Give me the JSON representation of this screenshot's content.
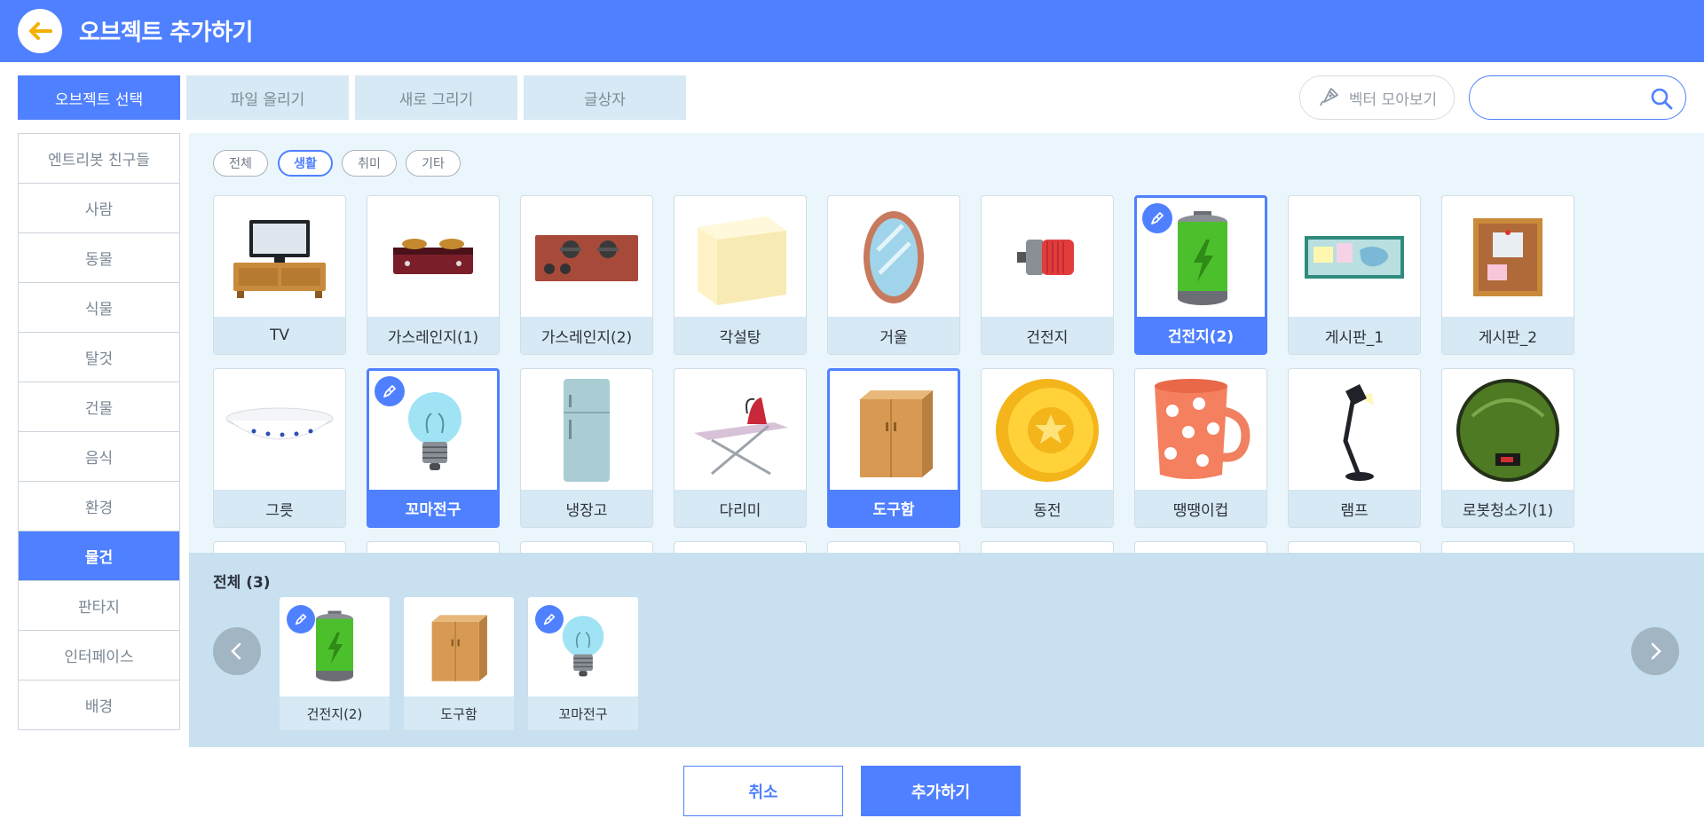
{
  "header": {
    "title": "오브젝트 추가하기",
    "back_icon": "back-arrow-icon"
  },
  "tabs": [
    {
      "label": "오브젝트 선택",
      "active": true
    },
    {
      "label": "파일 올리기",
      "active": false
    },
    {
      "label": "새로 그리기",
      "active": false
    },
    {
      "label": "글상자",
      "active": false
    }
  ],
  "vector_button": {
    "label": "벡터 모아보기",
    "icon": "vector-pen-icon"
  },
  "search": {
    "placeholder": "",
    "value": ""
  },
  "sidebar": {
    "items": [
      {
        "label": "엔트리봇 친구들"
      },
      {
        "label": "사람"
      },
      {
        "label": "동물"
      },
      {
        "label": "식물"
      },
      {
        "label": "탈것"
      },
      {
        "label": "건물"
      },
      {
        "label": "음식"
      },
      {
        "label": "환경"
      },
      {
        "label": "물건",
        "active": true
      },
      {
        "label": "판타지"
      },
      {
        "label": "인터페이스"
      },
      {
        "label": "배경"
      }
    ]
  },
  "filters": [
    {
      "label": "전체"
    },
    {
      "label": "생활",
      "active": true
    },
    {
      "label": "취미"
    },
    {
      "label": "기타"
    }
  ],
  "objects": [
    {
      "label": "TV",
      "icon": "tv-icon"
    },
    {
      "label": "가스레인지(1)",
      "icon": "gas-stove-1-icon"
    },
    {
      "label": "가스레인지(2)",
      "icon": "gas-stove-2-icon"
    },
    {
      "label": "각설탕",
      "icon": "sugar-cube-icon"
    },
    {
      "label": "거울",
      "icon": "mirror-icon"
    },
    {
      "label": "건전지",
      "icon": "battery-icon"
    },
    {
      "label": "건전지(2)",
      "icon": "battery-2-icon",
      "selected": true,
      "vector": true
    },
    {
      "label": "게시판_1",
      "icon": "bulletin-board-1-icon"
    },
    {
      "label": "게시판_2",
      "icon": "bulletin-board-2-icon"
    },
    {
      "label": "그릇",
      "icon": "bowl-icon"
    },
    {
      "label": "꼬마전구",
      "icon": "light-bulb-icon",
      "selected": true,
      "vector": true
    },
    {
      "label": "냉장고",
      "icon": "refrigerator-icon"
    },
    {
      "label": "다리미",
      "icon": "iron-icon"
    },
    {
      "label": "도구함",
      "icon": "toolbox-icon",
      "selected": true
    },
    {
      "label": "동전",
      "icon": "coin-icon"
    },
    {
      "label": "땡땡이컵",
      "icon": "polka-dot-cup-icon"
    },
    {
      "label": "램프",
      "icon": "desk-lamp-icon"
    },
    {
      "label": "로봇청소기(1)",
      "icon": "robot-vacuum-icon"
    }
  ],
  "tray": {
    "title": "전체 (3)",
    "items": [
      {
        "label": "건전지(2)",
        "icon": "battery-2-icon",
        "vector": true
      },
      {
        "label": "도구함",
        "icon": "toolbox-icon"
      },
      {
        "label": "꼬마전구",
        "icon": "light-bulb-icon",
        "vector": true
      }
    ]
  },
  "footer": {
    "cancel_label": "취소",
    "add_label": "추가하기"
  },
  "colors": {
    "accent": "#4f80ff",
    "panel": "#eaf6fc",
    "tray": "#c8e0ef",
    "label_bg": "#d6e9f4"
  }
}
